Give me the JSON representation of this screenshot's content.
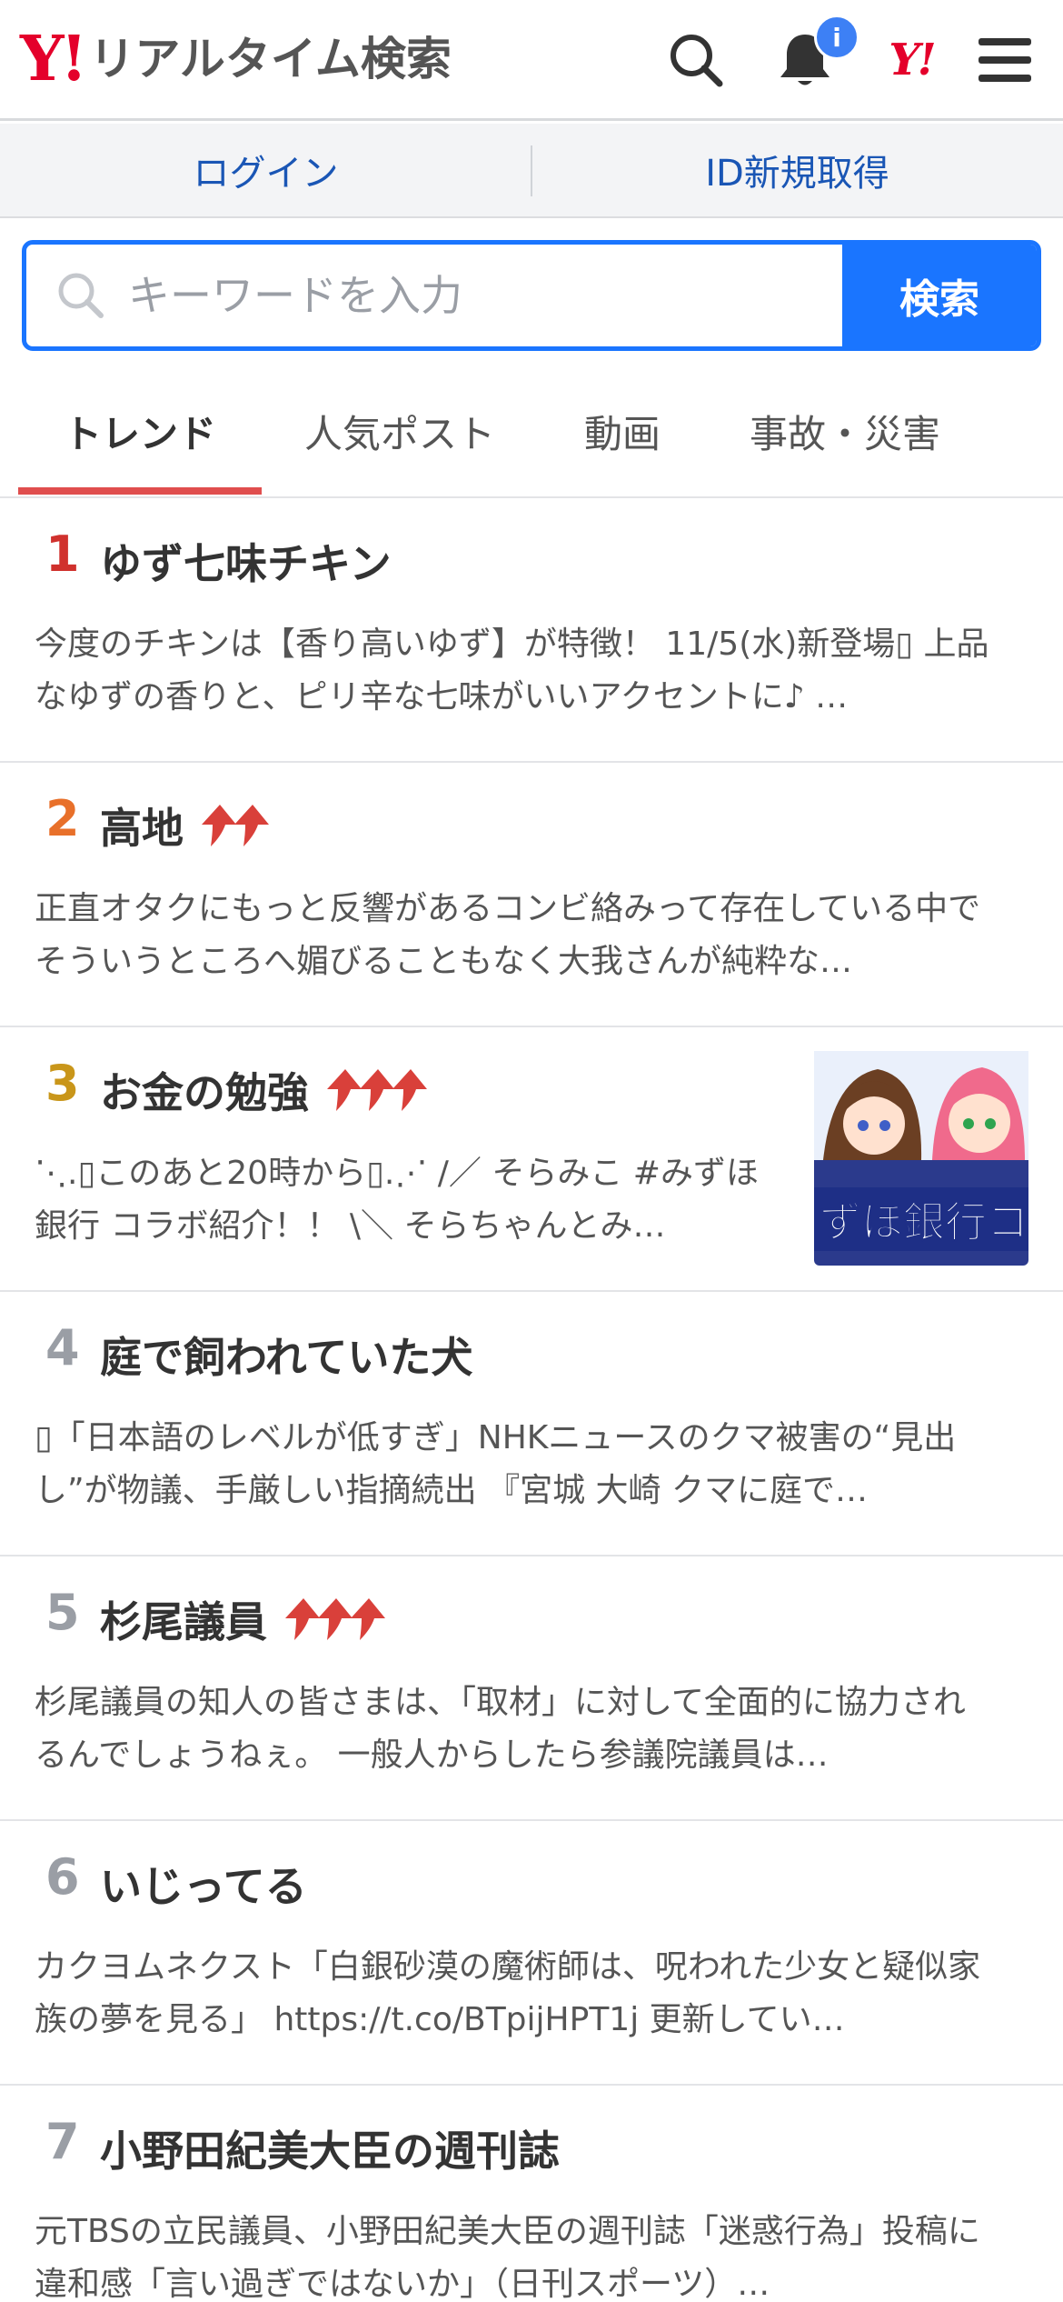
{
  "header": {
    "logo_mark": "Y!",
    "logo_text": "リアルタイム検索",
    "notification_count": "i",
    "yahoo_mark": "Y!"
  },
  "auth": {
    "login": "ログイン",
    "register": "ID新規取得"
  },
  "search": {
    "placeholder": "キーワードを入力",
    "button": "検索"
  },
  "tabs": [
    {
      "label": "トレンド"
    },
    {
      "label": "人気ポスト"
    },
    {
      "label": "動画"
    },
    {
      "label": "事故・災害"
    }
  ],
  "trends": [
    {
      "rank": "1",
      "title": "ゆず七味チキン",
      "arrows": 0,
      "rank_color": "#d0312d",
      "desc": "今度のチキンは【香り高いゆず】が特徴！ 11/5(水)新登場▯ 上品なゆずの香りと、ピリ辛な七味がいいアクセントに♪ …"
    },
    {
      "rank": "2",
      "title": "高地",
      "arrows": 2,
      "rank_color": "#e8702a",
      "desc": "正直オタクにもっと反響があるコンビ絡みって存在している中でそういうところへ媚びることもなく大我さんが純粋な…"
    },
    {
      "rank": "3",
      "title": "お金の勉強",
      "arrows": 3,
      "rank_color": "#c9961a",
      "desc": "⋱.▯このあと20時から▯.⋰ /／ そらみこ #みずほ銀行 コラボ紹介！！ \\＼ そらちゃんとみ…",
      "thumb_text": "ずほ銀行コラ"
    },
    {
      "rank": "4",
      "title": "庭で飼われていた犬",
      "arrows": 0,
      "rank_color": "#9a9ea5",
      "desc": "▯「日本語のレベルが低すぎ」NHKニュースのクマ被害の“見出し”が物議、手厳しい指摘続出 『宮城 大崎 クマに庭で…"
    },
    {
      "rank": "5",
      "title": "杉尾議員",
      "arrows": 3,
      "rank_color": "#9a9ea5",
      "desc": "杉尾議員の知人の皆さまは、「取材」に対して全面的に協力されるんでしょうねぇ。 一般人からしたら参議院議員は…"
    },
    {
      "rank": "6",
      "title": "いじってる",
      "arrows": 0,
      "rank_color": "#9a9ea5",
      "desc": "カクヨムネクスト「白銀砂漠の魔術師は、呪われた少女と疑似家族の夢を見る」 https://t.co/BTpijHPT1j 更新してい…"
    },
    {
      "rank": "7",
      "title": "小野田紀美大臣の週刊誌",
      "arrows": 0,
      "rank_color": "#9a9ea5",
      "desc": "元TBSの立民議員、小野田紀美大臣の週刊誌「迷惑行為」投稿に違和感「言い過ぎではないか」（日刊スポーツ）…"
    }
  ],
  "colors": {
    "accent_blue": "#1a75ff",
    "brand_red": "#e4002b",
    "tab_underline": "#e04e4e",
    "trend_arrow": "#d9403a"
  }
}
